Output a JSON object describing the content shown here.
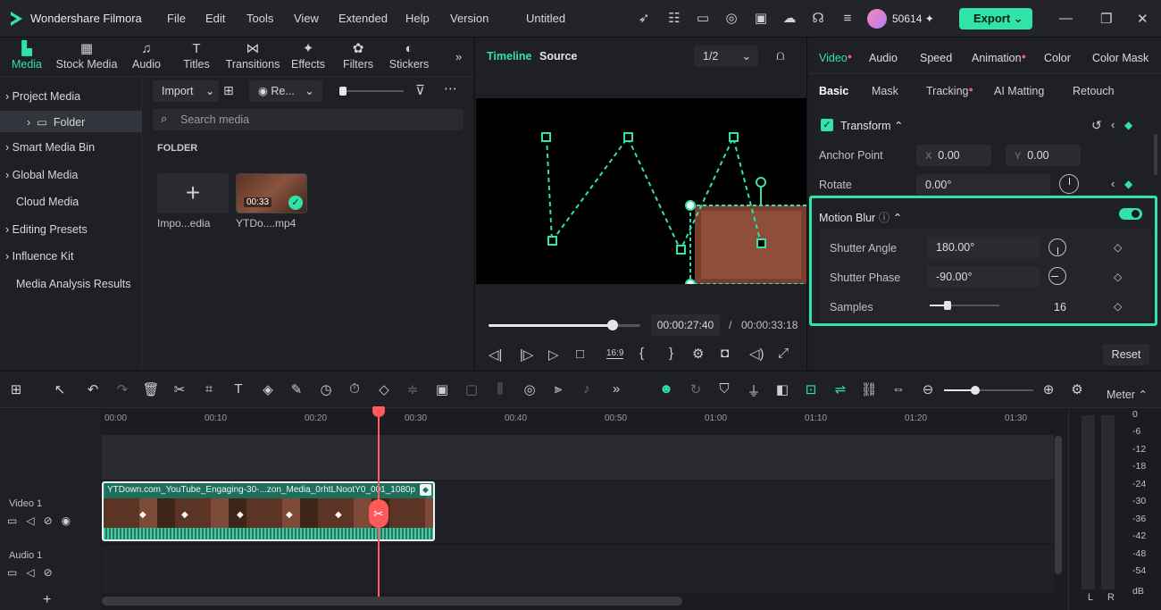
{
  "app": {
    "name": "Wondershare Filmora",
    "project_title": "Untitled",
    "credits": "50614",
    "export_label": "Export"
  },
  "menu": [
    "File",
    "Edit",
    "Tools",
    "View",
    "Extended",
    "Help",
    "Version"
  ],
  "media_tabs": [
    {
      "label": "Media",
      "icon": "folder-icon"
    },
    {
      "label": "Stock Media",
      "icon": "stock-icon"
    },
    {
      "label": "Audio",
      "icon": "music-icon"
    },
    {
      "label": "Titles",
      "icon": "titles-icon"
    },
    {
      "label": "Transitions",
      "icon": "transitions-icon"
    },
    {
      "label": "Effects",
      "icon": "effects-icon"
    },
    {
      "label": "Filters",
      "icon": "filters-icon"
    },
    {
      "label": "Stickers",
      "icon": "stickers-icon"
    }
  ],
  "sidebar": {
    "items": [
      "Project Media",
      "Folder",
      "Smart Media Bin",
      "Global Media",
      "Cloud Media",
      "Editing Presets",
      "Influence Kit",
      "Media Analysis Results"
    ]
  },
  "media": {
    "import_label": "Import",
    "record_label": "Re...",
    "search_placeholder": "Search media",
    "folder_heading": "FOLDER",
    "import_tile_caption": "Impo...edia",
    "clip_caption": "YTDo....mp4",
    "clip_duration": "00:33"
  },
  "preview": {
    "tab_timeline": "Timeline",
    "tab_source": "Source",
    "quality": "1/2",
    "current_time": "00:00:27:40",
    "separator": "/",
    "total_time": "00:00:33:18",
    "progress": 0.82,
    "aspect": "16:9"
  },
  "props": {
    "tabs": [
      "Video",
      "Audio",
      "Speed",
      "Animation",
      "Color",
      "Color Mask"
    ],
    "subtabs": [
      "Basic",
      "Mask",
      "Tracking",
      "AI Matting",
      "Retouch"
    ],
    "transform_label": "Transform",
    "anchor_label": "Anchor Point",
    "anchor_x_axis": "X",
    "anchor_x": "0.00",
    "anchor_y_axis": "Y",
    "anchor_y": "0.00",
    "rotate_label": "Rotate",
    "rotate_value": "0.00°",
    "motion_blur_label": "Motion Blur",
    "shutter_angle_label": "Shutter Angle",
    "shutter_angle": "180.00°",
    "shutter_phase_label": "Shutter Phase",
    "shutter_phase": "-90.00°",
    "samples_label": "Samples",
    "samples": "16",
    "samples_fraction": 0.25,
    "reset_label": "Reset"
  },
  "timeline": {
    "ticks": [
      "00:00",
      "00:10",
      "00:20",
      "00:30",
      "00:40",
      "00:50",
      "01:00",
      "01:10",
      "01:20",
      "01:30"
    ],
    "video_track": "Video 1",
    "audio_track": "Audio 1",
    "clip_name": "YTDown.com_YouTube_Engaging-30-...zon_Media_0rhtLNootY0_001_1080p",
    "meter_label": "Meter",
    "db_scale": [
      "0",
      "-6",
      "-12",
      "-18",
      "-24",
      "-30",
      "-36",
      "-42",
      "-48",
      "-54",
      "dB"
    ],
    "meter_l": "L",
    "meter_r": "R"
  },
  "colors": {
    "accent": "#2fe3a9",
    "playhead": "#ff5a5a",
    "clip": "#2a7f6b"
  }
}
